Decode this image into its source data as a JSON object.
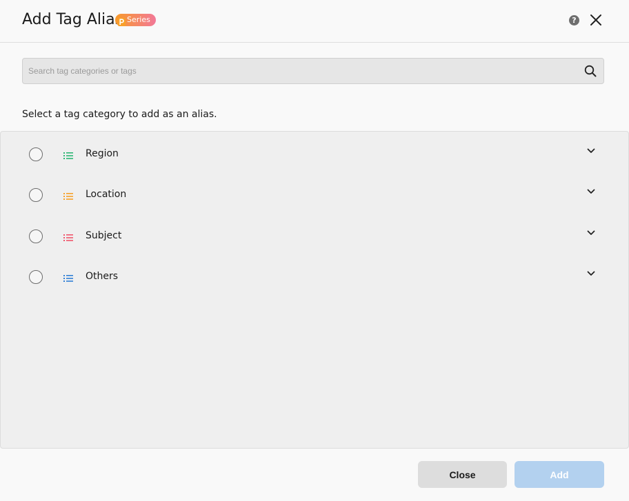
{
  "dialog": {
    "title": "Add Tag Alias",
    "badge": {
      "letter": "P",
      "label": "Series"
    },
    "help_icon": "help-icon",
    "help_glyph": "?",
    "close_icon": "close-icon"
  },
  "search": {
    "placeholder": "Search tag categories or tags",
    "value": "",
    "icon": "search-icon"
  },
  "instruction": "Select a tag category to add as an alias.",
  "categories": [
    {
      "label": "Region",
      "icon": "list-icon",
      "color": "#2bb673",
      "selected": false
    },
    {
      "label": "Location",
      "icon": "list-icon",
      "color": "#f7a127",
      "selected": false
    },
    {
      "label": "Subject",
      "icon": "list-icon",
      "color": "#f0556b",
      "selected": false
    },
    {
      "label": "Others",
      "icon": "list-icon",
      "color": "#2f7fd6",
      "selected": false
    }
  ],
  "footer": {
    "close_label": "Close",
    "add_label": "Add"
  },
  "colors": {
    "badge_start": "#f89a2a",
    "badge_end": "#f27898",
    "add_button_disabled": "#b3d1ef",
    "close_button": "#dddddd"
  }
}
